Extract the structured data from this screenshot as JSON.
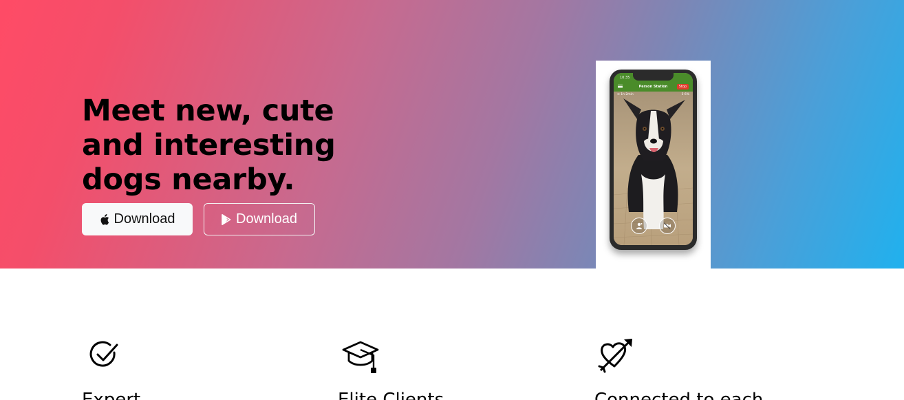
{
  "hero": {
    "title": "Meet new, cute and interesting dogs nearby.",
    "ios_button_label": "Download",
    "android_button_label": "Download",
    "gradient_colors": [
      "#ff4b66",
      "#20b1ee"
    ]
  },
  "phone": {
    "time": "10:35",
    "app_title": "Person Station",
    "stop_label": "Stop",
    "status_left": "⊙ 1h 2min",
    "status_right": "5 6%",
    "app_bar_color": "#4a8c2a",
    "icons": [
      "menu-icon",
      "person-icon",
      "video-off-icon"
    ]
  },
  "features": [
    {
      "icon": "check-circle-icon",
      "title": "Expert"
    },
    {
      "icon": "graduation-cap-icon",
      "title": "Elite Clients"
    },
    {
      "icon": "heart-arrow-icon",
      "title": "Connected to each"
    }
  ]
}
